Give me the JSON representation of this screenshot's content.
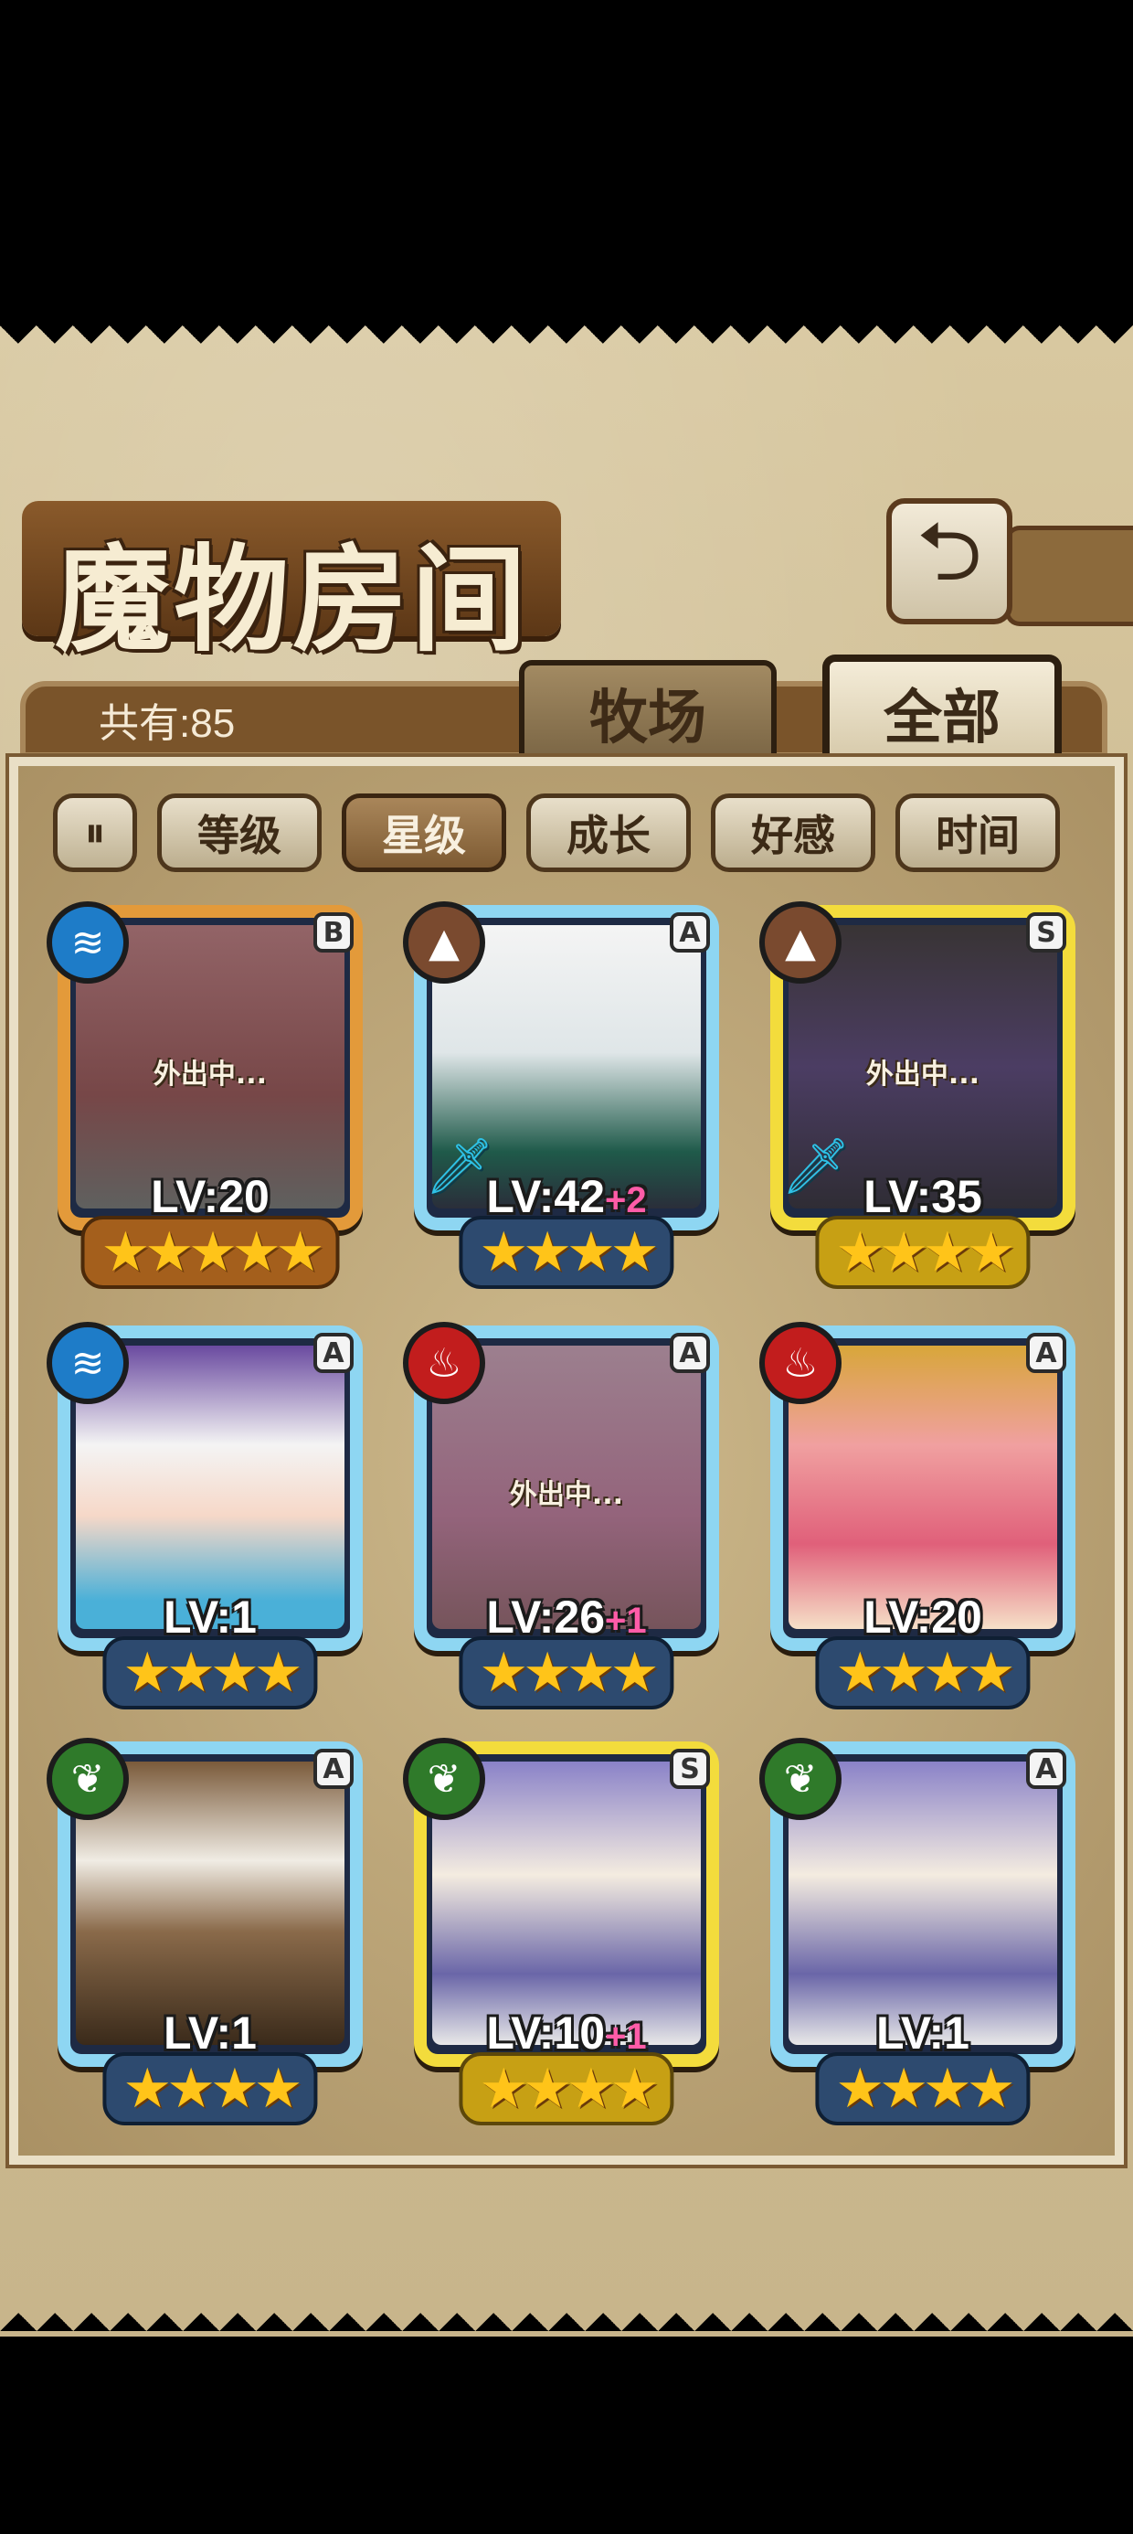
{
  "header": {
    "title": "魔物房间",
    "count_label": "共有:85",
    "tabs": [
      {
        "label": "牧场",
        "active": false
      },
      {
        "label": "全部",
        "active": true
      }
    ]
  },
  "sort": {
    "options": [
      "等级",
      "星级",
      "成长",
      "好感",
      "时间"
    ],
    "active": "星级"
  },
  "cards": [
    {
      "grade": "B",
      "element": "water",
      "level": "LV:20",
      "plus": "",
      "stars": "★★★★★",
      "status": "外出中...",
      "weapon": false
    },
    {
      "grade": "A",
      "element": "earth",
      "level": "LV:42",
      "plus": "+2",
      "stars": "★★★★",
      "status": "",
      "weapon": true
    },
    {
      "grade": "S",
      "element": "earth",
      "level": "LV:35",
      "plus": "",
      "stars": "★★★★",
      "status": "外出中...",
      "weapon": true
    },
    {
      "grade": "A",
      "element": "water",
      "level": "LV:1",
      "plus": "",
      "stars": "★★★★",
      "status": "",
      "weapon": false
    },
    {
      "grade": "A",
      "element": "fire",
      "level": "LV:26",
      "plus": "+1",
      "stars": "★★★★",
      "status": "外出中...",
      "weapon": false
    },
    {
      "grade": "A",
      "element": "fire",
      "level": "LV:20",
      "plus": "",
      "stars": "★★★★",
      "status": "",
      "weapon": false
    },
    {
      "grade": "A",
      "element": "wood",
      "level": "LV:1",
      "plus": "",
      "stars": "★★★★",
      "status": "",
      "weapon": false
    },
    {
      "grade": "S",
      "element": "wood",
      "level": "LV:10",
      "plus": "+1",
      "stars": "★★★★",
      "status": "",
      "weapon": false
    },
    {
      "grade": "A",
      "element": "wood",
      "level": "LV:1",
      "plus": "",
      "stars": "★★★★",
      "status": "",
      "weapon": false
    }
  ],
  "colors": {
    "panel": "#cdbb92",
    "frame_A": "#8ed6f2",
    "frame_S": "#f3dc3c",
    "frame_B": "#e39a3a",
    "star": "#ffc419",
    "plus": "#ff5ca8"
  },
  "icons": {
    "back": "return-arrow-icon",
    "sort_toggle": "sort-toggle-icon",
    "elements": {
      "water": "water-waves-icon",
      "earth": "mountain-icon",
      "fire": "flame-icon",
      "wood": "leaf-icon"
    },
    "weapon": "sword-icon"
  }
}
